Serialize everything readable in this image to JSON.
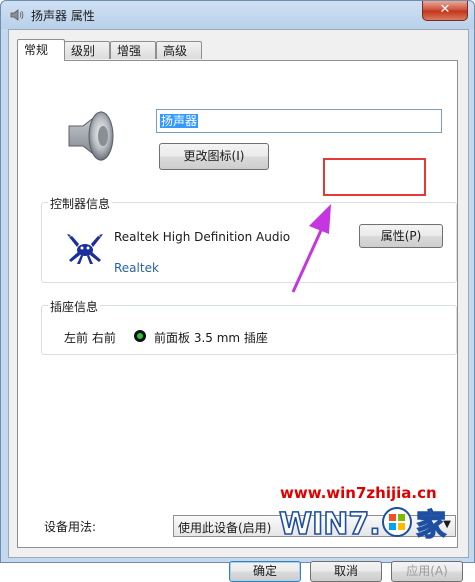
{
  "window": {
    "title": "扬声器 属性",
    "close_glyph": "✕"
  },
  "tabs": [
    {
      "label": "常规",
      "active": true
    },
    {
      "label": "级别",
      "active": false
    },
    {
      "label": "增强",
      "active": false
    },
    {
      "label": "高级",
      "active": false
    }
  ],
  "general": {
    "device_name_value": "扬声器",
    "change_icon_button": "更改图标(I)"
  },
  "controller": {
    "group_title": "控制器信息",
    "device_name": "Realtek High Definition Audio",
    "vendor_link": "Realtek",
    "properties_button": "属性(P)"
  },
  "jack": {
    "group_title": "插座信息",
    "channels": "左前 右前",
    "description": "前面板 3.5 mm 插座",
    "jack_color": "#22c63a"
  },
  "usage": {
    "label": "设备用法:",
    "selected": "使用此设备(启用)"
  },
  "footer": {
    "ok_button": "确定",
    "cancel_button": "取消",
    "apply_button": "应用(A)"
  },
  "watermark": {
    "url": "www.win7zhijia.cn",
    "logo_text": "WIN7.",
    "logo_suffix": "家"
  },
  "colors": {
    "highlight_border": "#e23a3a",
    "annotation_arrow": "#c436e0",
    "watermark_red": "#e00000",
    "link_blue": "#2a63a4"
  }
}
